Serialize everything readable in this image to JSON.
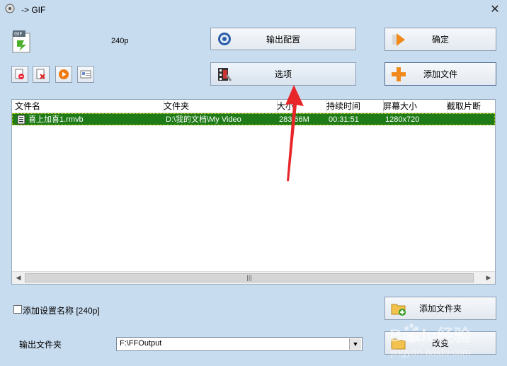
{
  "window": {
    "title": "-> GIF"
  },
  "preset_label": "240p",
  "buttons": {
    "output_config": "输出配置",
    "options": "选项",
    "ok": "确定",
    "add_file": "添加文件",
    "add_folder": "添加文件夹",
    "change": "改变"
  },
  "table": {
    "columns": [
      "文件名",
      "文件夹",
      "大小",
      "持续时间",
      "屏幕大小",
      "截取片断"
    ],
    "rows": [
      {
        "name": "喜上加喜1.rmvb",
        "folder": "D:\\我的文档\\My Video",
        "size": "283.66M",
        "duration": "00:31:51",
        "resolution": "1280x720",
        "clip": ""
      }
    ]
  },
  "add_preset": {
    "label": "添加设置名称 [240p]",
    "checked": false
  },
  "output_folder": {
    "label": "输出文件夹",
    "value": "F:\\FFOutput"
  },
  "watermark": {
    "brand": "Baidu经验",
    "url": "jingyan.baidu.com"
  },
  "colors": {
    "background": "#c8dcf0",
    "selected_row": "#1f7a18",
    "accent_orange": "#f08a1c"
  }
}
